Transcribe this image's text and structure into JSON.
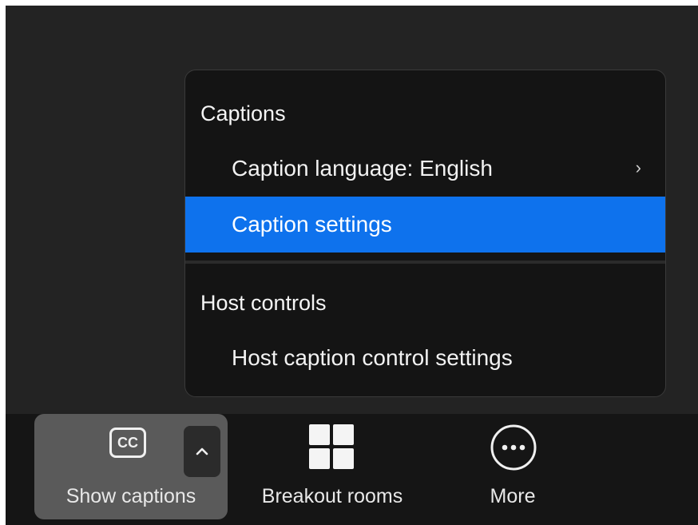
{
  "menu": {
    "section_captions": "Captions",
    "caption_language": "Caption language: English",
    "caption_language_chevron": "›",
    "caption_settings": "Caption settings",
    "section_host": "Host controls",
    "host_caption_settings": "Host caption control settings",
    "selected_item": "Caption settings",
    "accent_color": "#0e72ed"
  },
  "toolbar": {
    "show_captions": {
      "label": "Show captions",
      "icon": "cc-icon",
      "icon_text": "CC",
      "caret_icon": "chevron-up-icon",
      "active": true
    },
    "breakout_rooms": {
      "label": "Breakout rooms",
      "icon": "grid-icon"
    },
    "more": {
      "label": "More",
      "icon": "more-horizontal-icon"
    }
  }
}
